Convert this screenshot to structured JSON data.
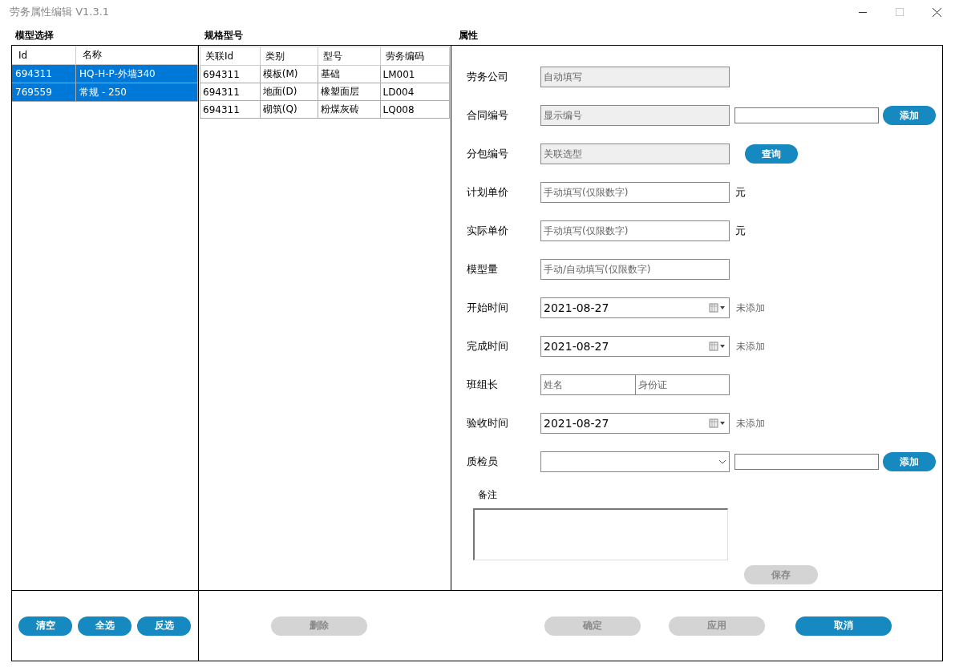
{
  "window": {
    "title": "劳务属性编辑 V1.3.1"
  },
  "model_panel": {
    "heading": "模型选择",
    "columns": [
      "Id",
      "名称"
    ],
    "rows": [
      {
        "cells": [
          "694311",
          "HQ-H-P-外墙340"
        ],
        "selected": true
      },
      {
        "cells": [
          "769559",
          "常规 - 250"
        ],
        "selected": true
      }
    ]
  },
  "spec_panel": {
    "heading": "规格型号",
    "columns": [
      "关联Id",
      "类别",
      "型号",
      "劳务编码"
    ],
    "rows": [
      {
        "cells": [
          "694311",
          "模板(M)",
          "基础",
          "LM001"
        ],
        "selected": false
      },
      {
        "cells": [
          "694311",
          "地面(D)",
          "橡塑面层",
          "LD004"
        ],
        "selected": false
      },
      {
        "cells": [
          "694311",
          "砌筑(Q)",
          "粉煤灰砖",
          "LQ008"
        ],
        "selected": false
      }
    ]
  },
  "properties": {
    "heading": "属性",
    "fields": [
      {
        "kind": "readonly",
        "label": "劳务公司",
        "placeholder": "自动填写"
      },
      {
        "kind": "readonly",
        "label": "合同编号",
        "placeholder": "显示编号",
        "side_input": true,
        "button": {
          "label": "添加",
          "disabled": false
        }
      },
      {
        "kind": "readonly",
        "label": "分包编号",
        "placeholder": "关联选型",
        "button": {
          "label": "查询",
          "disabled": false
        }
      },
      {
        "kind": "text",
        "label": "计划单价",
        "placeholder": "手动填写(仅限数字)",
        "suffix": "元"
      },
      {
        "kind": "text",
        "label": "实际单价",
        "placeholder": "手动填写(仅限数字)",
        "suffix": "元"
      },
      {
        "kind": "text",
        "label": "模型量",
        "placeholder": "手动/自动填写(仅限数字)"
      },
      {
        "kind": "date",
        "label": "开始时间",
        "value": "2021-08-27",
        "status": "未添加"
      },
      {
        "kind": "date",
        "label": "完成时间",
        "value": "2021-08-27",
        "status": "未添加"
      },
      {
        "kind": "pair",
        "label": "班组长",
        "placeholders": [
          "姓名",
          "身份证"
        ]
      },
      {
        "kind": "date",
        "label": "验收时间",
        "value": "2021-08-27",
        "status": "未添加"
      },
      {
        "kind": "combo",
        "label": "质检员",
        "side_input": true,
        "button": {
          "label": "添加",
          "disabled": false
        }
      }
    ],
    "notes": {
      "label": "备注"
    },
    "save_button": {
      "label": "保存",
      "disabled": true
    }
  },
  "left_buttons": [
    {
      "label": "清空",
      "disabled": false
    },
    {
      "label": "全选",
      "disabled": false
    },
    {
      "label": "反选",
      "disabled": false
    }
  ],
  "action_buttons": [
    {
      "label": "删除",
      "disabled": true
    },
    {
      "label": "确定",
      "disabled": true
    },
    {
      "label": "应用",
      "disabled": true
    },
    {
      "label": "取消",
      "disabled": false
    }
  ]
}
